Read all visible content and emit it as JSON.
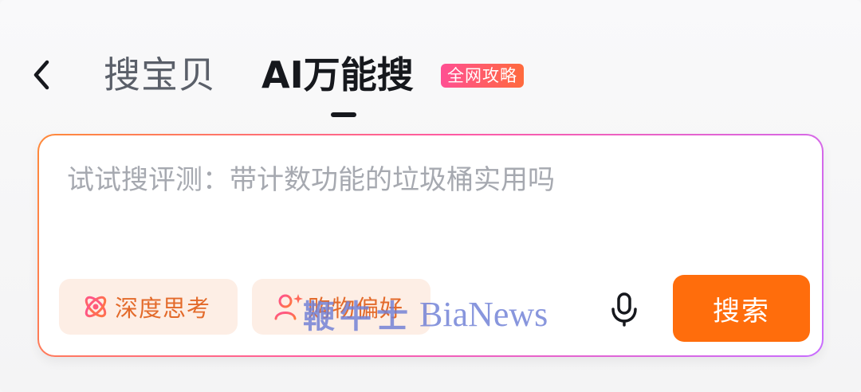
{
  "header": {
    "back_icon": "chevron-left-icon",
    "tabs": [
      {
        "label": "搜宝贝",
        "active": false
      },
      {
        "label": "AI万能搜",
        "active": true
      }
    ],
    "badge": "全网攻略"
  },
  "search": {
    "placeholder": "试试搜评测：带计数功能的垃圾桶实用吗",
    "chips": [
      {
        "label": "深度思考",
        "icon": "atom-orbit-icon"
      },
      {
        "label": "购物偏好",
        "icon": "user-sparkle-icon"
      }
    ],
    "mic_icon": "microphone-icon",
    "button_label": "搜索"
  },
  "watermark": {
    "cn": "鞭牛士",
    "en": "BiaNews"
  },
  "colors": {
    "accent": "#ff6d0c",
    "chip_bg": "#fdeee5",
    "chip_text": "#e36a2a",
    "badge_start": "#ff4f93",
    "badge_end": "#ff6a3d",
    "watermark": "#6f7fd6"
  }
}
